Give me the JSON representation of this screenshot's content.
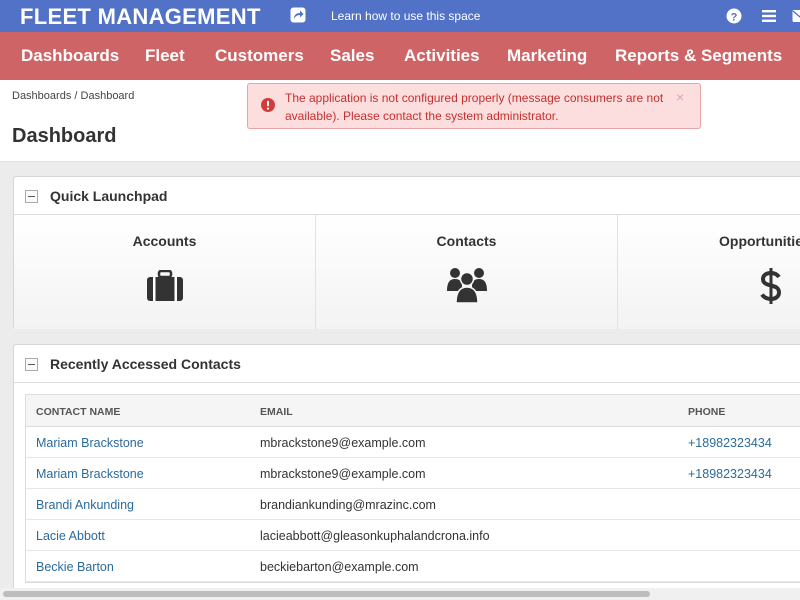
{
  "app": {
    "title": "FLEET MANAGEMENT",
    "learn_link": "Learn how to use this space"
  },
  "nav": {
    "items": [
      "Dashboards",
      "Fleet",
      "Customers",
      "Sales",
      "Activities",
      "Marketing",
      "Reports & Segments"
    ]
  },
  "breadcrumb": {
    "dashboards": "Dashboards",
    "sep": "/",
    "current": "Dashboard"
  },
  "page": {
    "title": "Dashboard"
  },
  "alert": {
    "text": "The application is not configured properly (message consumers are not available). Please contact the system administrator.",
    "close": "×",
    "color": "#c6302e"
  },
  "launchpad": {
    "title": "Quick Launchpad",
    "tiles": [
      {
        "label": "Accounts",
        "icon": "briefcase-icon"
      },
      {
        "label": "Contacts",
        "icon": "users-icon"
      },
      {
        "label": "Opportunities",
        "icon": "dollar-icon"
      }
    ]
  },
  "contacts": {
    "title": "Recently Accessed Contacts",
    "columns": [
      "CONTACT NAME",
      "EMAIL",
      "PHONE"
    ],
    "rows": [
      {
        "name": "Mariam Brackstone",
        "email": "mbrackstone9@example.com",
        "phone": "+18982323434"
      },
      {
        "name": "Mariam Brackstone",
        "email": "mbrackstone9@example.com",
        "phone": "+18982323434"
      },
      {
        "name": "Brandi Ankunding",
        "email": "brandiankunding@mrazinc.com",
        "phone": ""
      },
      {
        "name": "Lacie Abbott",
        "email": "lacieabbott@gleasonkuphalandcrona.info",
        "phone": ""
      },
      {
        "name": "Beckie Barton",
        "email": "beckiebarton@example.com",
        "phone": ""
      }
    ]
  },
  "colors": {
    "topbar": "#5272c8",
    "navbar": "#cf6466",
    "link": "#2a6b9c",
    "alert_bg": "#fcdede"
  }
}
